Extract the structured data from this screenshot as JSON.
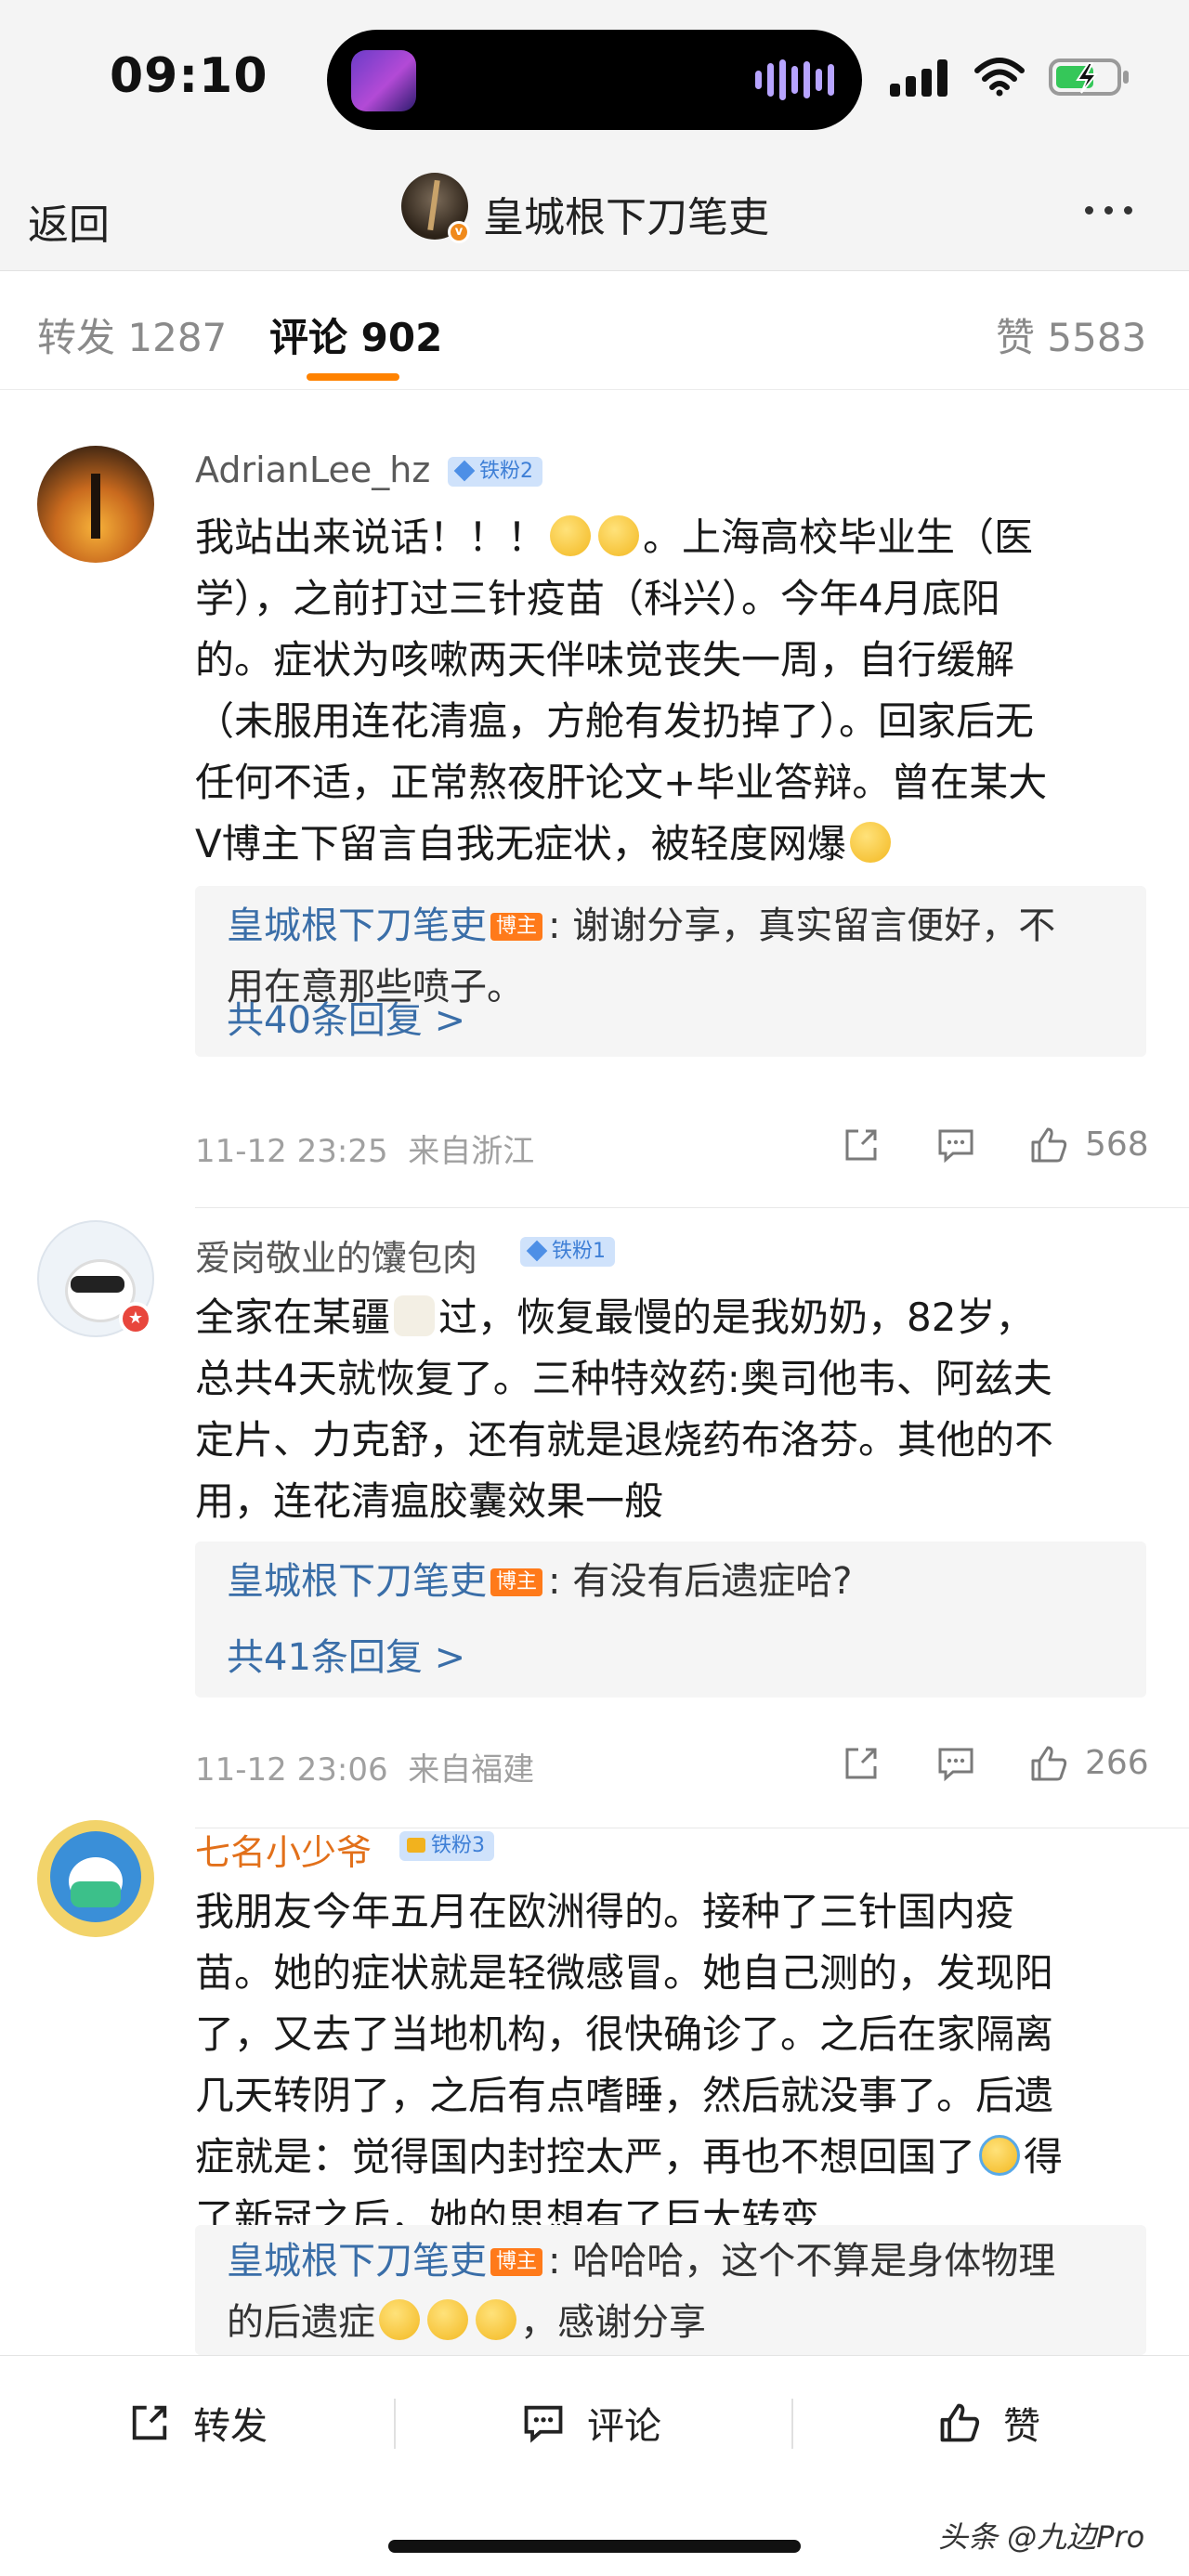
{
  "status_bar": {
    "time": "09:10"
  },
  "header": {
    "back_label": "返回",
    "title": "皇城根下刀笔吏",
    "verified_mark": "v"
  },
  "tabs": [
    {
      "label": "转发",
      "count": "1287"
    },
    {
      "label": "评论",
      "count": "902"
    },
    {
      "label": "赞",
      "count": "5583"
    }
  ],
  "comments": [
    {
      "username": "AdrianLee_hz",
      "fan_badge": "铁粉2",
      "text": [
        "我站出来说话！！！",
        "。上海高校毕业生（医",
        "学），之前打过三针疫苗（科兴）。今年4月底阳",
        "的。症状为咳嗽两天伴味觉丧失一周，自行缓解",
        "（未服用连花清瘟，方舱有发扔掉了）。回家后无",
        "任何不适，正常熬夜肝论文+毕业答辩。曾在某大",
        "V博主下留言自我无症状，被轻度网爆"
      ],
      "reply": {
        "author": "皇城根下刀笔吏",
        "owner_tag": "博主",
        "text_1": ": 谢谢分享，真实留言便好，不",
        "text_2": "用在意那些喷子。",
        "more": "共40条回复 >"
      },
      "time": "11-12 23:25",
      "location": "来自浙江",
      "likes": "568"
    },
    {
      "username": "爱岗敬业的馕包肉",
      "fan_badge": "铁粉1",
      "text": [
        "全家在某疆",
        "过，恢复最慢的是我奶奶，82岁，",
        "总共4天就恢复了。三种特效药:奥司他韦、阿兹夫",
        "定片、力克舒，还有就是退烧药布洛芬。其他的不",
        "用，连花清瘟胶囊效果一般"
      ],
      "reply": {
        "author": "皇城根下刀笔吏",
        "owner_tag": "博主",
        "text_1": ": 有没有后遗症哈?",
        "more": "共41条回复 >"
      },
      "time": "11-12 23:06",
      "location": "来自福建",
      "likes": "266"
    },
    {
      "username": "七名小少爷",
      "fan_badge": "铁粉3",
      "text": [
        "我朋友今年五月在欧洲得的。接种了三针国内疫",
        "苗。她的症状就是轻微感冒。她自己测的，发现阳",
        "了，又去了当地机构，很快确诊了。之后在家隔离",
        "几天转阴了，之后有点嗜睡，然后就没事了。后遗",
        "症就是：觉得国内封控太严，再也不想回国了",
        "得",
        "了新冠之后，她的思想有了巨大转变..."
      ],
      "reply": {
        "author": "皇城根下刀笔吏",
        "owner_tag": "博主",
        "text_1": ": 哈哈哈，这个不算是身体物理",
        "text_2": "的后遗症",
        "text_3": "，感谢分享"
      }
    }
  ],
  "bottom_bar": {
    "repost": "转发",
    "comment": "评论",
    "like": "赞"
  },
  "watermark": "头条 @九边Pro",
  "colors": {
    "accent": "#ff8200",
    "link": "#3a6ea8",
    "owner_tag": "#ff7a1a",
    "fan_badge": "#cfe2fb"
  }
}
